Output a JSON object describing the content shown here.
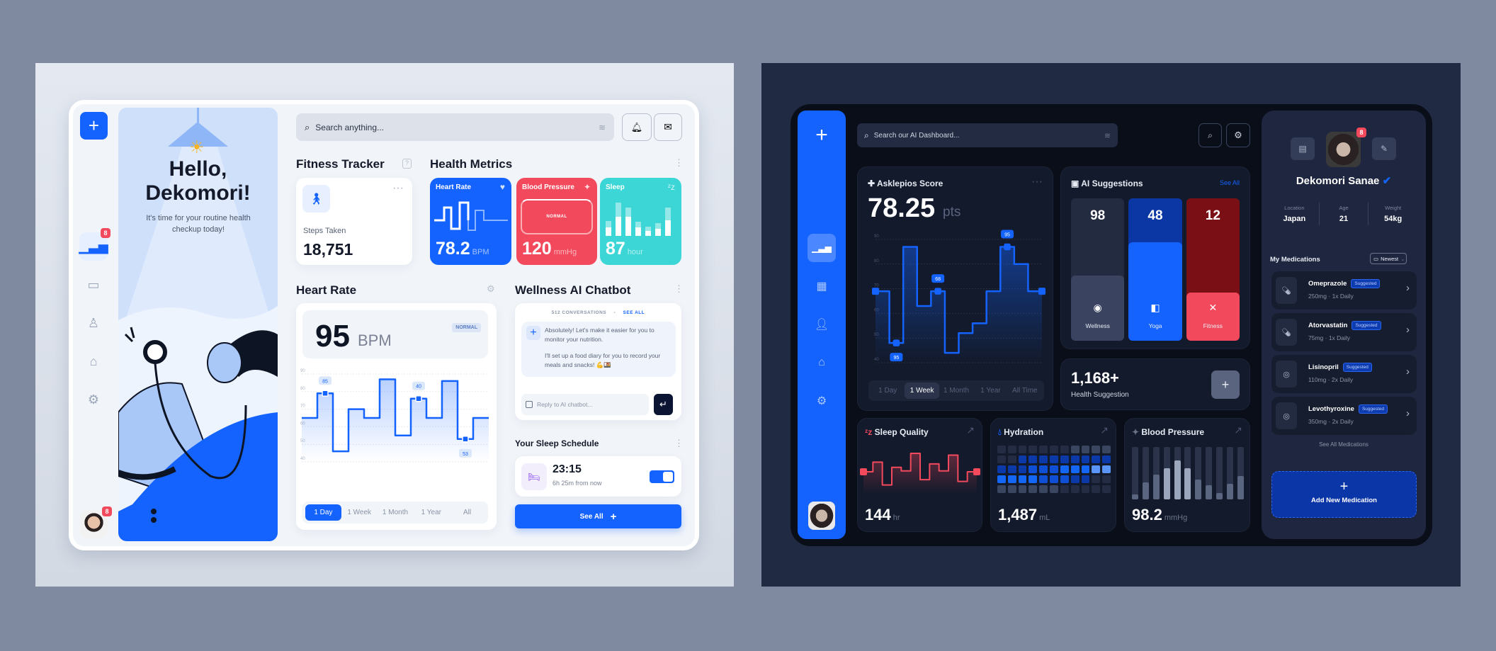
{
  "light": {
    "brand_icon": "plus-cross-icon",
    "sidebar": {
      "items": [
        {
          "icon": "bar-chart-icon",
          "badge": "8",
          "active": true
        },
        {
          "icon": "calendar-icon"
        },
        {
          "icon": "user-icon"
        },
        {
          "icon": "home-icon"
        },
        {
          "icon": "gear-icon"
        }
      ],
      "avatar_badge": "8"
    },
    "hero": {
      "greeting": "Hello,",
      "name": "Dekomori!",
      "subtitle": "It's time for your routine health checkup today!"
    },
    "search": {
      "placeholder": "Search anything..."
    },
    "fitness": {
      "title": "Fitness Tracker",
      "label": "Steps Taken",
      "value": "18,751"
    },
    "health_metrics": {
      "title": "Health Metrics",
      "cards": [
        {
          "label": "Heart Rate",
          "value": "78.2",
          "unit": "BPM",
          "color": "#1463ff"
        },
        {
          "label": "Blood Pressure",
          "value": "120",
          "unit": "mmHg",
          "status": "NORMAL",
          "color": "#f2495c"
        },
        {
          "label": "Sleep",
          "value": "87",
          "unit": "hour",
          "color": "#3dd6d6",
          "bars": [
            [
              0.42,
              0.24
            ],
            [
              0.95,
              0.55
            ],
            [
              0.8,
              0.55
            ],
            [
              0.4,
              0.25
            ],
            [
              0.26,
              0.15
            ],
            [
              0.36,
              0.2
            ],
            [
              0.8,
              0.45
            ]
          ]
        }
      ]
    },
    "heart_rate": {
      "title": "Heart Rate",
      "value": "95",
      "unit": "BPM",
      "status": "NORMAL",
      "chart": {
        "type": "line",
        "y_ticks": [
          "90",
          "80",
          "70",
          "60",
          "50",
          "40"
        ],
        "ylim": [
          40,
          90
        ],
        "values": [
          65,
          79,
          46,
          70,
          65,
          87,
          55,
          76,
          65,
          86,
          53,
          65
        ],
        "markers": [
          {
            "index": 1,
            "label": "85"
          },
          {
            "index": 7,
            "label": "40"
          },
          {
            "index": 10,
            "label": "53",
            "below": true
          }
        ]
      },
      "tabs": [
        "1 Day",
        "1 Week",
        "1 Month",
        "1 Year",
        "All"
      ],
      "active_tab": 0
    },
    "chatbot": {
      "title": "Wellness AI Chatbot",
      "conversations": "512 CONVERSATIONS",
      "see_all": "SEE ALL",
      "message1": "Absolutely! Let's make it easier for you to monitor your nutrition.",
      "message2": "I'll set up a food diary for you to record your meals and snacks! 💪🍱",
      "reply_placeholder": "Reply to AI chatbot..."
    },
    "sleep_schedule": {
      "title": "Your Sleep Schedule",
      "time": "23:15",
      "relative": "6h 25m from now",
      "enabled": true
    },
    "see_all_button": "See All"
  },
  "dark": {
    "search": {
      "placeholder": "Search our AI Dashboard..."
    },
    "score": {
      "title": "Asklepios Score",
      "value": "78.25",
      "unit": "pts",
      "chart": {
        "type": "line",
        "y_ticks": [
          "90",
          "80",
          "70",
          "60",
          "50",
          "40"
        ],
        "ylim": [
          40,
          90
        ],
        "values": [
          69,
          48,
          87,
          63,
          69,
          44,
          52,
          56,
          69,
          87,
          80,
          69
        ],
        "markers": [
          {
            "index": 1,
            "label": "95",
            "below": true
          },
          {
            "index": 4,
            "label": "68"
          },
          {
            "index": 9,
            "label": "95"
          }
        ]
      },
      "tabs": [
        "1 Day",
        "1 Week",
        "1 Month",
        "1 Year",
        "All Time"
      ],
      "active_tab": 1
    },
    "ai_suggestions": {
      "title": "AI Suggestions",
      "see_all": "See All",
      "items": [
        {
          "value": "98",
          "label": "Wellness",
          "fill": 0.46,
          "bg": "#232b40",
          "fg": "#3a4460"
        },
        {
          "value": "48",
          "label": "Yoga",
          "fill": 0.69,
          "bg": "#0a37a3",
          "fg": "#1463ff"
        },
        {
          "value": "12",
          "label": "Fitness",
          "fill": 0.34,
          "bg": "#7a1016",
          "fg": "#f2495c"
        }
      ]
    },
    "health_suggestion": {
      "value": "1,168+",
      "label": "Health Suggestion"
    },
    "sleep_quality": {
      "title": "Sleep Quality",
      "value": "144",
      "unit": "hr",
      "values": [
        65,
        76,
        50,
        70,
        66,
        86,
        56,
        74,
        66,
        84,
        54,
        65
      ]
    },
    "hydration": {
      "title": "Hydration",
      "value": "1,487",
      "unit": "mL",
      "grid": [
        [
          1,
          1,
          1,
          1,
          1,
          1,
          1,
          2,
          2,
          2,
          2
        ],
        [
          1,
          1,
          3,
          3,
          3,
          3,
          3,
          3,
          3,
          3,
          3
        ],
        [
          3,
          3,
          3,
          4,
          4,
          4,
          5,
          5,
          5,
          6,
          6
        ],
        [
          5,
          5,
          5,
          5,
          4,
          4,
          4,
          3,
          3,
          1,
          1
        ],
        [
          2,
          2,
          2,
          2,
          2,
          2,
          1,
          1,
          1,
          1,
          1
        ]
      ]
    },
    "blood_pressure": {
      "title": "Blood Pressure",
      "value": "98.2",
      "unit": "mmHg",
      "bars": [
        0.1,
        0.33,
        0.47,
        0.6,
        0.75,
        0.59,
        0.38,
        0.27,
        0.12,
        0.3,
        0.44
      ]
    },
    "profile": {
      "name": "Dekomori Sanae",
      "badge": "8",
      "stats": [
        {
          "label": "Location",
          "value": "Japan"
        },
        {
          "label": "Age",
          "value": "21"
        },
        {
          "label": "Weight",
          "value": "54kg"
        }
      ],
      "medications_title": "My Medications",
      "sort": "Newest",
      "medications": [
        {
          "name": "Omeprazole",
          "dose": "250mg",
          "freq": "1x Daily",
          "tag": "Suggested"
        },
        {
          "name": "Atorvastatin",
          "dose": "75mg",
          "freq": "1x Daily",
          "tag": "Suggested"
        },
        {
          "name": "Lisinopril",
          "dose": "110mg",
          "freq": "2x Daily",
          "tag": "Suggested"
        },
        {
          "name": "Levothyroxine",
          "dose": "350mg",
          "freq": "2x Daily",
          "tag": "Suggested"
        }
      ],
      "see_all": "See All Medications",
      "add_button": "Add New Medication"
    }
  }
}
